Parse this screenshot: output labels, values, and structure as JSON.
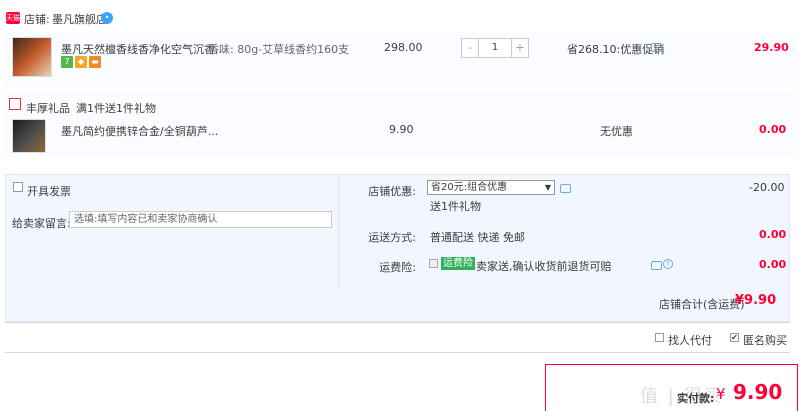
{
  "store": {
    "badge": "天猫",
    "label": "店铺:",
    "name": "墨凡旗舰店",
    "chat_icon": "chat-icon"
  },
  "item": {
    "title": "墨凡天然檀香线香净化空气沉香...",
    "sku": "香味: 80g-艾草线香约160支",
    "price": "298.00",
    "quantity": "1",
    "qty_minus": "-",
    "qty_plus": "+",
    "discount": "省268.10:优惠促销",
    "subtotal": "29.90"
  },
  "gift": {
    "label": "丰厚礼品",
    "rule": "满1件送1件礼物",
    "title": "墨凡简约便携锌合金/全铜葫芦...",
    "price": "9.90",
    "discount": "无优惠",
    "subtotal": "0.00"
  },
  "options": {
    "invoice_label": "开具发票",
    "message_label": "给卖家留言:",
    "message_placeholder": "选填:填写内容已和卖家协商确认",
    "promo_label": "店铺优惠:",
    "promo_selected": "省20元:组合优惠",
    "promo_sub": "送1件礼物",
    "promo_amount": "-20.00",
    "shipping_label": "运送方式:",
    "shipping_value": "普通配送 快递 免邮",
    "shipping_amount": "0.00",
    "insurance_label": "运费险:",
    "insurance_tag": "运费险",
    "insurance_text": "卖家送,确认收货前退货可赔",
    "insurance_amount": "0.00",
    "total_label": "店铺合计(含运费)",
    "total_value": "¥9.90"
  },
  "footer": {
    "proxy_label": "找人代付",
    "anon_label": "匿名购买",
    "anon_checked": true,
    "pay_label": "实付款:",
    "pay_currency": "¥",
    "pay_value": "9.90",
    "watermark": "值 | 得买"
  },
  "colors": {
    "accent": "#ff0036",
    "panel": "#f2f7ff",
    "insurance_green": "#2fb05a"
  }
}
